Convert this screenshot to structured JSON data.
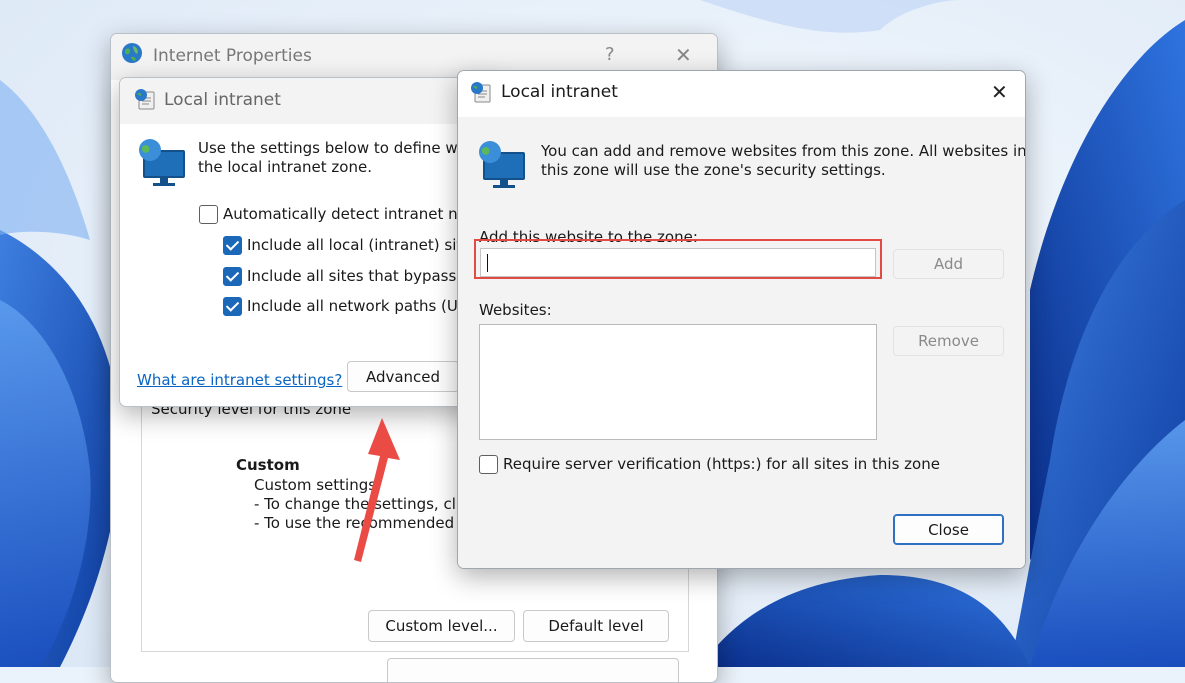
{
  "colors": {
    "accent": "#1b67b8",
    "highlight": "#e24a44",
    "arrow": "#ea4b45",
    "link": "#0b65c2"
  },
  "internet_properties": {
    "title": "Internet Properties",
    "help_glyph": "?",
    "close_glyph": "✕",
    "security_level_label": "Security level for this zone",
    "level_name": "Custom",
    "level_desc": [
      "Custom settings.",
      "- To change the settings, clic",
      "- To use the recommended s"
    ],
    "custom_level_label": "Custom level...",
    "default_level_label": "Default level"
  },
  "intranet_dialog": {
    "title": "Local intranet",
    "desc_line1": "Use the settings below to define whic",
    "desc_line2": "the local intranet zone.",
    "options": [
      {
        "label": "Automatically detect intranet netw",
        "checked": false
      },
      {
        "label": "Include all local (intranet) sites",
        "checked": true
      },
      {
        "label": "Include all sites that bypass th",
        "checked": true
      },
      {
        "label": "Include all network paths (UN",
        "checked": true
      }
    ],
    "help_link": "What are intranet settings?",
    "advanced_label": "Advanced"
  },
  "sites_dialog": {
    "title": "Local intranet",
    "close_glyph": "✕",
    "desc_line1": "You can add and remove websites from this zone. All websites in",
    "desc_line2": "this zone will use the zone's security settings.",
    "add_label": "Add this website to the zone:",
    "add_value": "",
    "add_button": "Add",
    "websites_label": "Websites:",
    "remove_button": "Remove",
    "require_https_label": "Require server verification (https:) for all sites in this zone",
    "require_https_checked": false,
    "close_button": "Close"
  }
}
